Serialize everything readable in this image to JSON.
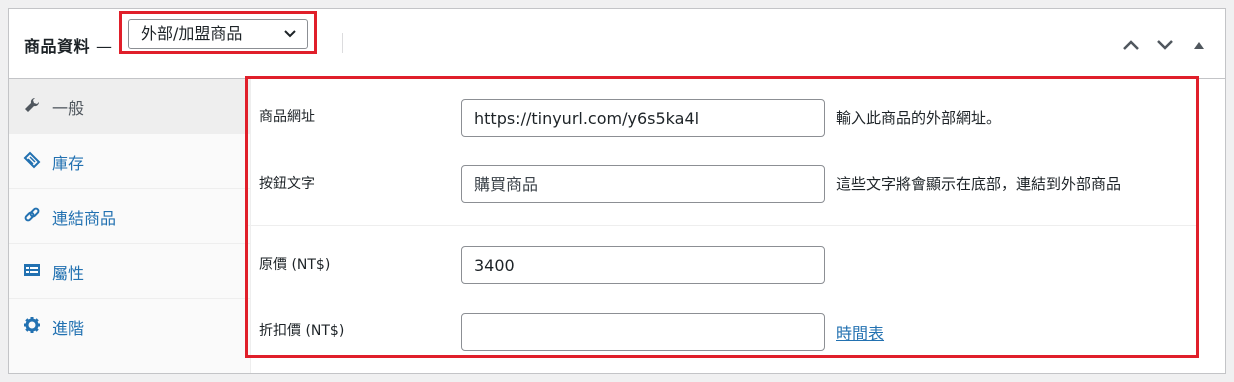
{
  "header": {
    "title": "商品資料",
    "dash": "—",
    "product_type": "外部/加盟商品"
  },
  "sidebar": {
    "items": [
      {
        "label": "一般",
        "icon": "wrench-icon"
      },
      {
        "label": "庫存",
        "icon": "tag-icon"
      },
      {
        "label": "連結商品",
        "icon": "link-icon"
      },
      {
        "label": "屬性",
        "icon": "list-icon"
      },
      {
        "label": "進階",
        "icon": "gear-icon"
      }
    ]
  },
  "fields": {
    "product_url": {
      "label": "商品網址",
      "value": "https://tinyurl.com/y6s5ka4l",
      "description": "輸入此商品的外部網址。"
    },
    "button_text": {
      "label": "按鈕文字",
      "placeholder": "購買商品",
      "description": "這些文字將會顯示在底部，連結到外部商品"
    },
    "regular_price": {
      "label": "原價 (NT$)",
      "value": "3400"
    },
    "sale_price": {
      "label": "折扣價 (NT$)",
      "value": "",
      "schedule_link": "時間表"
    }
  },
  "colors": {
    "accent": "#2271b1",
    "highlight": "#e01f2a"
  }
}
